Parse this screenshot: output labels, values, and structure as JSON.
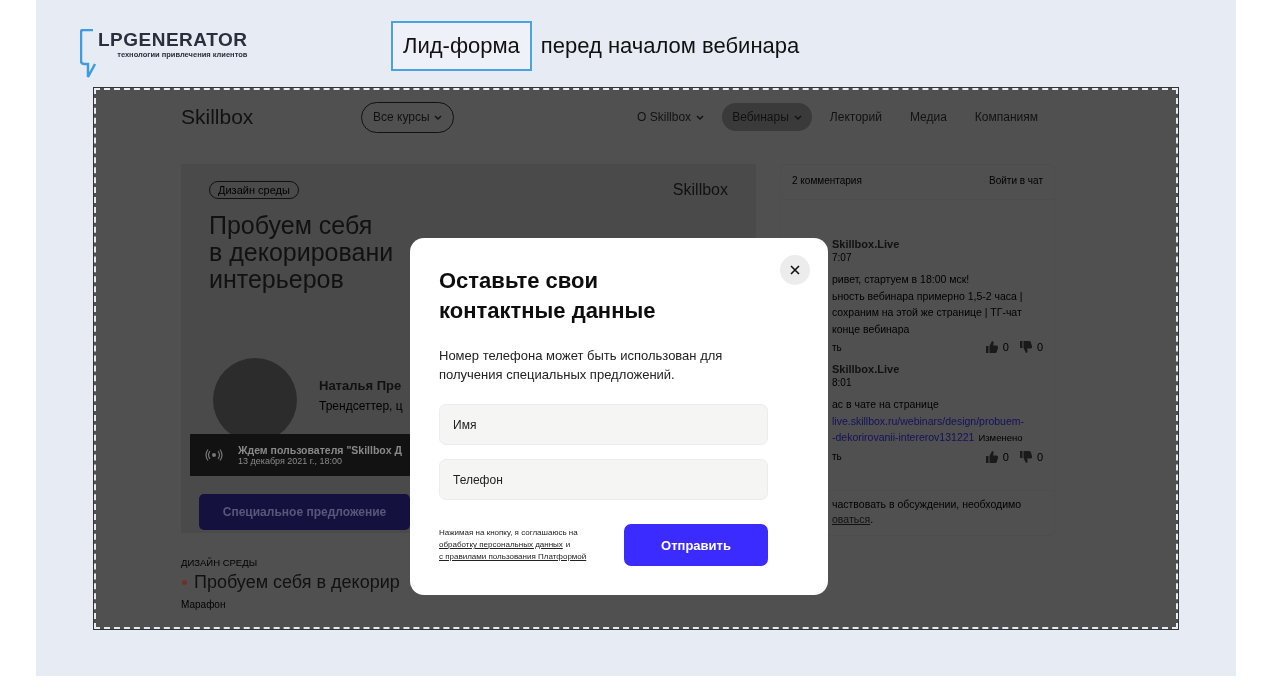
{
  "slide": {
    "logo": {
      "name": "LPGENERATOR",
      "tagline": "технологии привлечения клиентов"
    },
    "title_highlight": "Лид-форма",
    "title_rest": "перед началом вебинара"
  },
  "site": {
    "logo": "Skillbox",
    "courses_button": "Все курсы",
    "nav": [
      {
        "label": "О Skillbox",
        "has_caret": true,
        "selected": false
      },
      {
        "label": "Вебинары",
        "has_caret": true,
        "selected": true
      },
      {
        "label": "Лекторий",
        "has_caret": false,
        "selected": false
      },
      {
        "label": "Медиа",
        "has_caret": false,
        "selected": false
      },
      {
        "label": "Компаниям",
        "has_caret": false,
        "selected": false
      }
    ]
  },
  "hero": {
    "tag": "Дизайн среды",
    "brand": "Skillbox",
    "title_lines": [
      "Пробуем себя",
      "в декорировани",
      "интерьеров"
    ],
    "speaker_name": "Наталья Пре",
    "speaker_role": "Трендсеттер, ц",
    "live_status": "Ждем пользователя \"Skillbox Д",
    "live_date": "13 декабря 2021 г., 18:00",
    "offer_button": "Специальное предложение"
  },
  "below": {
    "category": "ДИЗАЙН СРЕДЫ",
    "title": "Пробуем себя в декорир",
    "type": "Марафон"
  },
  "chat": {
    "count": "2 комментария",
    "login": "Войти в чат",
    "messages": [
      {
        "author": "Skillbox.Live",
        "time": "7:07",
        "lines": [
          [
            {
              "kind": "text",
              "text": "ривет, стартуем в 18:00 мск!"
            }
          ],
          [
            {
              "kind": "text",
              "text": "ьность вебинара примерно 1,5-2 часа |"
            }
          ],
          [
            {
              "kind": "text",
              "text": "сохраним на этой же странице | ТГ-чат"
            }
          ],
          [
            {
              "kind": "text",
              "text": "конце вебинара"
            }
          ]
        ],
        "reply": "ть",
        "likes": "0",
        "dislikes": "0"
      },
      {
        "author": "Skillbox.Live",
        "time": "8:01",
        "lines": [
          [
            {
              "kind": "text",
              "text": "ас в чате на странице"
            }
          ],
          [
            {
              "kind": "link",
              "text": "live.skillbox.ru/webinars/design/probuem-"
            }
          ],
          [
            {
              "kind": "link",
              "text": "-dekorirovanii-intererov131221"
            },
            {
              "kind": "note",
              "text": "Изменено"
            }
          ]
        ],
        "reply": "ть",
        "likes": "0",
        "dislikes": "0"
      }
    ],
    "footer_text": "частвовать в обсуждении, необходимо",
    "footer_link": "оваться",
    "footer_end": "."
  },
  "modal": {
    "title": "Оставьте свои контактные данные",
    "description": "Номер телефона может быть использован для получения специальных предложений.",
    "fields": [
      {
        "placeholder": "Имя"
      },
      {
        "placeholder": "Телефон"
      }
    ],
    "consent_text": "Нажимая на кнопку, я соглашаюсь на",
    "consent_link_1": "обработку персональных данных",
    "consent_and": "и",
    "consent_link_2": "с правилами пользования Платформой",
    "submit": "Отправить"
  }
}
